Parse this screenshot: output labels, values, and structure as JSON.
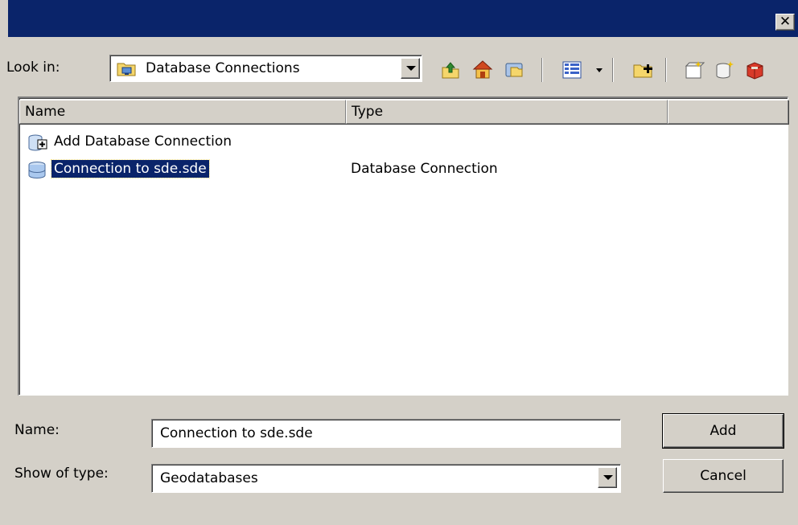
{
  "window": {
    "close_glyph": "✕"
  },
  "lookin": {
    "label": "Look in:",
    "value": "Database Connections",
    "icon": "folder-database-icon"
  },
  "toolbar": {
    "icons": [
      "up-one-level-icon",
      "home-icon",
      "connect-folder-icon",
      "view-menu-icon",
      "new-folder-icon",
      "new-item-icon",
      "new-database-icon",
      "toolbox-icon"
    ]
  },
  "list": {
    "columns": [
      "Name",
      "Type",
      ""
    ],
    "rows": [
      {
        "name": "Add Database Connection",
        "type": "",
        "icon": "add-database-connection-icon",
        "selected": false
      },
      {
        "name": "Connection to sde.sde",
        "type": "Database Connection",
        "icon": "database-icon",
        "selected": true
      }
    ]
  },
  "name_field": {
    "label": "Name:",
    "value": "Connection to sde.sde"
  },
  "type_field": {
    "label": "Show of type:",
    "value": "Geodatabases"
  },
  "buttons": {
    "add": "Add",
    "cancel": "Cancel"
  },
  "colors": {
    "titlebar": "#0a246a",
    "selection": "#0a246a",
    "face": "#d4d0c8"
  }
}
